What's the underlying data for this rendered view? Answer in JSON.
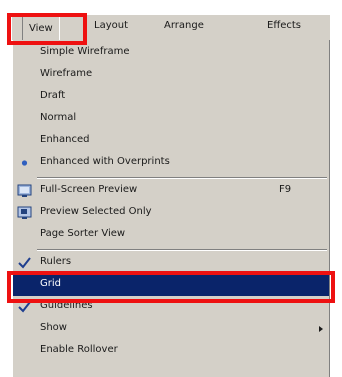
{
  "menubar": {
    "items": [
      {
        "label": "View",
        "active": true
      },
      {
        "label": "Layout"
      },
      {
        "label": "Arrange"
      },
      {
        "label": "Effects"
      }
    ]
  },
  "dropdown": {
    "items": [
      {
        "label": "Simple Wireframe"
      },
      {
        "label": "Wireframe"
      },
      {
        "label": "Draft"
      },
      {
        "label": "Normal"
      },
      {
        "label": "Enhanced"
      },
      {
        "label": "Enhanced with Overprints",
        "icon": "bullet-dot-icon"
      },
      {
        "label": "Full-Screen Preview",
        "shortcut": "F9",
        "icon": "full-screen-preview-icon"
      },
      {
        "label": "Preview Selected Only",
        "icon": "preview-selected-icon"
      },
      {
        "label": "Page Sorter View"
      },
      {
        "label": "Rulers",
        "icon": "checkmark-icon"
      },
      {
        "label": "Grid",
        "selected": true
      },
      {
        "label": "Guidelines",
        "icon": "checkmark-icon"
      },
      {
        "label": "Show",
        "submenu": true,
        "icon": "submenu-arrow-icon"
      },
      {
        "label": "Enable Rollover"
      }
    ]
  },
  "colors": {
    "menu_bg": "#d4d0c8",
    "selection_bg": "#0a246a",
    "annotation": "#ee1111",
    "checkmark": "#1f3f8f",
    "bullet": "#2f5fbf"
  }
}
